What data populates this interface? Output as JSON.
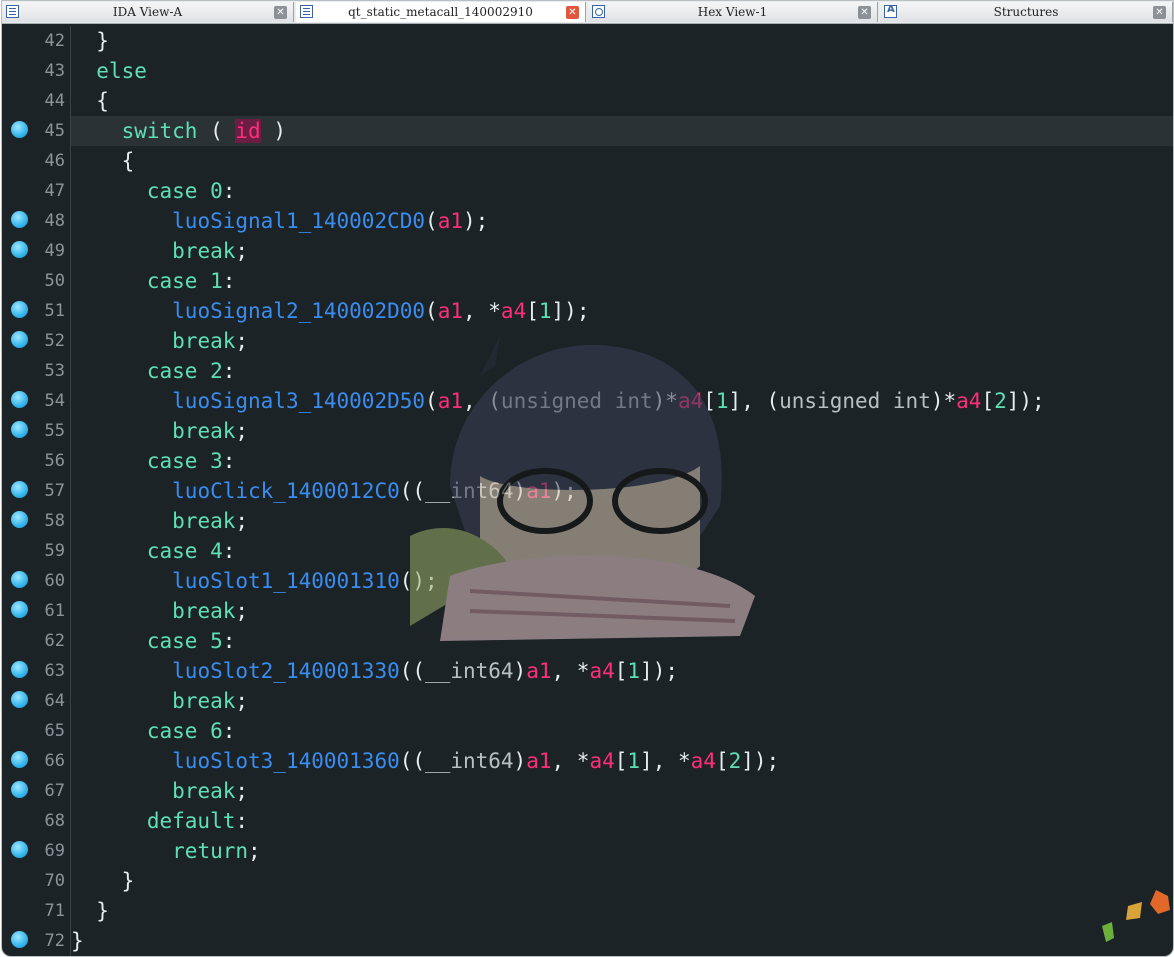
{
  "tabs": [
    {
      "label": "IDA View-A",
      "icon": "disassembly-icon",
      "active": false
    },
    {
      "label": "qt_static_metacall_140002910",
      "icon": "pseudocode-icon",
      "active": true
    },
    {
      "label": "Hex View-1",
      "icon": "hex-icon",
      "active": false
    },
    {
      "label": "Structures",
      "icon": "structures-icon",
      "active": false
    }
  ],
  "colors": {
    "background": "#1c2326",
    "keyword": "#5fe0b4",
    "function": "#3a8df0",
    "variable": "#ff2e7a",
    "punctuation": "#e6edf0",
    "type": "#b8c0c4",
    "breakpoint": "#33b4ec"
  },
  "lines": [
    {
      "num": "42",
      "bp": false,
      "hl": false,
      "indent": "  ",
      "tokens": [
        {
          "t": "}",
          "c": "pn"
        }
      ]
    },
    {
      "num": "43",
      "bp": false,
      "hl": false,
      "indent": "  ",
      "tokens": [
        {
          "t": "else",
          "c": "kw"
        }
      ]
    },
    {
      "num": "44",
      "bp": false,
      "hl": false,
      "indent": "  ",
      "tokens": [
        {
          "t": "{",
          "c": "pn"
        }
      ]
    },
    {
      "num": "45",
      "bp": true,
      "hl": true,
      "indent": "    ",
      "tokens": [
        {
          "t": "switch",
          "c": "kw"
        },
        {
          "t": " ( ",
          "c": "pn"
        },
        {
          "t": "id",
          "c": "var",
          "sel": true
        },
        {
          "t": " )",
          "c": "pn"
        }
      ]
    },
    {
      "num": "46",
      "bp": false,
      "hl": false,
      "indent": "    ",
      "tokens": [
        {
          "t": "{",
          "c": "pn"
        }
      ]
    },
    {
      "num": "47",
      "bp": false,
      "hl": false,
      "indent": "      ",
      "tokens": [
        {
          "t": "case ",
          "c": "kw"
        },
        {
          "t": "0",
          "c": "num"
        },
        {
          "t": ":",
          "c": "pn"
        }
      ]
    },
    {
      "num": "48",
      "bp": true,
      "hl": false,
      "indent": "        ",
      "tokens": [
        {
          "t": "luoSignal1_140002CD0",
          "c": "fn"
        },
        {
          "t": "(",
          "c": "pn"
        },
        {
          "t": "a1",
          "c": "var"
        },
        {
          "t": ");",
          "c": "pn"
        }
      ]
    },
    {
      "num": "49",
      "bp": true,
      "hl": false,
      "indent": "        ",
      "tokens": [
        {
          "t": "break",
          "c": "kw"
        },
        {
          "t": ";",
          "c": "pn"
        }
      ]
    },
    {
      "num": "50",
      "bp": false,
      "hl": false,
      "indent": "      ",
      "tokens": [
        {
          "t": "case ",
          "c": "kw"
        },
        {
          "t": "1",
          "c": "num"
        },
        {
          "t": ":",
          "c": "pn"
        }
      ]
    },
    {
      "num": "51",
      "bp": true,
      "hl": false,
      "indent": "        ",
      "tokens": [
        {
          "t": "luoSignal2_140002D00",
          "c": "fn"
        },
        {
          "t": "(",
          "c": "pn"
        },
        {
          "t": "a1",
          "c": "var"
        },
        {
          "t": ", *",
          "c": "pn"
        },
        {
          "t": "a4",
          "c": "var"
        },
        {
          "t": "[",
          "c": "pn"
        },
        {
          "t": "1",
          "c": "num"
        },
        {
          "t": "]);",
          "c": "pn"
        }
      ]
    },
    {
      "num": "52",
      "bp": true,
      "hl": false,
      "indent": "        ",
      "tokens": [
        {
          "t": "break",
          "c": "kw"
        },
        {
          "t": ";",
          "c": "pn"
        }
      ]
    },
    {
      "num": "53",
      "bp": false,
      "hl": false,
      "indent": "      ",
      "tokens": [
        {
          "t": "case ",
          "c": "kw"
        },
        {
          "t": "2",
          "c": "num"
        },
        {
          "t": ":",
          "c": "pn"
        }
      ]
    },
    {
      "num": "54",
      "bp": true,
      "hl": false,
      "indent": "        ",
      "tokens": [
        {
          "t": "luoSignal3_140002D50",
          "c": "fn"
        },
        {
          "t": "(",
          "c": "pn"
        },
        {
          "t": "a1",
          "c": "var"
        },
        {
          "t": ", (",
          "c": "pn"
        },
        {
          "t": "unsigned int",
          "c": "type"
        },
        {
          "t": ")*",
          "c": "pn"
        },
        {
          "t": "a4",
          "c": "var"
        },
        {
          "t": "[",
          "c": "pn"
        },
        {
          "t": "1",
          "c": "num"
        },
        {
          "t": "], (",
          "c": "pn"
        },
        {
          "t": "unsigned int",
          "c": "type"
        },
        {
          "t": ")*",
          "c": "pn"
        },
        {
          "t": "a4",
          "c": "var"
        },
        {
          "t": "[",
          "c": "pn"
        },
        {
          "t": "2",
          "c": "num"
        },
        {
          "t": "]);",
          "c": "pn"
        }
      ]
    },
    {
      "num": "55",
      "bp": true,
      "hl": false,
      "indent": "        ",
      "tokens": [
        {
          "t": "break",
          "c": "kw"
        },
        {
          "t": ";",
          "c": "pn"
        }
      ]
    },
    {
      "num": "56",
      "bp": false,
      "hl": false,
      "indent": "      ",
      "tokens": [
        {
          "t": "case ",
          "c": "kw"
        },
        {
          "t": "3",
          "c": "num"
        },
        {
          "t": ":",
          "c": "pn"
        }
      ]
    },
    {
      "num": "57",
      "bp": true,
      "hl": false,
      "indent": "        ",
      "tokens": [
        {
          "t": "luoClick_1400012C0",
          "c": "fn"
        },
        {
          "t": "((",
          "c": "pn"
        },
        {
          "t": "__int64",
          "c": "type"
        },
        {
          "t": ")",
          "c": "pn"
        },
        {
          "t": "a1",
          "c": "var"
        },
        {
          "t": ");",
          "c": "pn"
        }
      ]
    },
    {
      "num": "58",
      "bp": true,
      "hl": false,
      "indent": "        ",
      "tokens": [
        {
          "t": "break",
          "c": "kw"
        },
        {
          "t": ";",
          "c": "pn"
        }
      ]
    },
    {
      "num": "59",
      "bp": false,
      "hl": false,
      "indent": "      ",
      "tokens": [
        {
          "t": "case ",
          "c": "kw"
        },
        {
          "t": "4",
          "c": "num"
        },
        {
          "t": ":",
          "c": "pn"
        }
      ]
    },
    {
      "num": "60",
      "bp": true,
      "hl": false,
      "indent": "        ",
      "tokens": [
        {
          "t": "luoSlot1_140001310",
          "c": "fn"
        },
        {
          "t": "();",
          "c": "pn"
        }
      ]
    },
    {
      "num": "61",
      "bp": true,
      "hl": false,
      "indent": "        ",
      "tokens": [
        {
          "t": "break",
          "c": "kw"
        },
        {
          "t": ";",
          "c": "pn"
        }
      ]
    },
    {
      "num": "62",
      "bp": false,
      "hl": false,
      "indent": "      ",
      "tokens": [
        {
          "t": "case ",
          "c": "kw"
        },
        {
          "t": "5",
          "c": "num"
        },
        {
          "t": ":",
          "c": "pn"
        }
      ]
    },
    {
      "num": "63",
      "bp": true,
      "hl": false,
      "indent": "        ",
      "tokens": [
        {
          "t": "luoSlot2_140001330",
          "c": "fn"
        },
        {
          "t": "((",
          "c": "pn"
        },
        {
          "t": "__int64",
          "c": "type"
        },
        {
          "t": ")",
          "c": "pn"
        },
        {
          "t": "a1",
          "c": "var"
        },
        {
          "t": ", *",
          "c": "pn"
        },
        {
          "t": "a4",
          "c": "var"
        },
        {
          "t": "[",
          "c": "pn"
        },
        {
          "t": "1",
          "c": "num"
        },
        {
          "t": "]);",
          "c": "pn"
        }
      ]
    },
    {
      "num": "64",
      "bp": true,
      "hl": false,
      "indent": "        ",
      "tokens": [
        {
          "t": "break",
          "c": "kw"
        },
        {
          "t": ";",
          "c": "pn"
        }
      ]
    },
    {
      "num": "65",
      "bp": false,
      "hl": false,
      "indent": "      ",
      "tokens": [
        {
          "t": "case ",
          "c": "kw"
        },
        {
          "t": "6",
          "c": "num"
        },
        {
          "t": ":",
          "c": "pn"
        }
      ]
    },
    {
      "num": "66",
      "bp": true,
      "hl": false,
      "indent": "        ",
      "tokens": [
        {
          "t": "luoSlot3_140001360",
          "c": "fn"
        },
        {
          "t": "((",
          "c": "pn"
        },
        {
          "t": "__int64",
          "c": "type"
        },
        {
          "t": ")",
          "c": "pn"
        },
        {
          "t": "a1",
          "c": "var"
        },
        {
          "t": ", *",
          "c": "pn"
        },
        {
          "t": "a4",
          "c": "var"
        },
        {
          "t": "[",
          "c": "pn"
        },
        {
          "t": "1",
          "c": "num"
        },
        {
          "t": "], *",
          "c": "pn"
        },
        {
          "t": "a4",
          "c": "var"
        },
        {
          "t": "[",
          "c": "pn"
        },
        {
          "t": "2",
          "c": "num"
        },
        {
          "t": "]);",
          "c": "pn"
        }
      ]
    },
    {
      "num": "67",
      "bp": true,
      "hl": false,
      "indent": "        ",
      "tokens": [
        {
          "t": "break",
          "c": "kw"
        },
        {
          "t": ";",
          "c": "pn"
        }
      ]
    },
    {
      "num": "68",
      "bp": false,
      "hl": false,
      "indent": "      ",
      "tokens": [
        {
          "t": "default",
          "c": "kw"
        },
        {
          "t": ":",
          "c": "pn"
        }
      ]
    },
    {
      "num": "69",
      "bp": true,
      "hl": false,
      "indent": "        ",
      "tokens": [
        {
          "t": "return",
          "c": "kw"
        },
        {
          "t": ";",
          "c": "pn"
        }
      ]
    },
    {
      "num": "70",
      "bp": false,
      "hl": false,
      "indent": "    ",
      "tokens": [
        {
          "t": "}",
          "c": "pn"
        }
      ]
    },
    {
      "num": "71",
      "bp": false,
      "hl": false,
      "indent": "  ",
      "tokens": [
        {
          "t": "}",
          "c": "pn"
        }
      ]
    },
    {
      "num": "72",
      "bp": true,
      "hl": false,
      "indent": "",
      "tokens": [
        {
          "t": "}",
          "c": "pn"
        }
      ]
    }
  ]
}
